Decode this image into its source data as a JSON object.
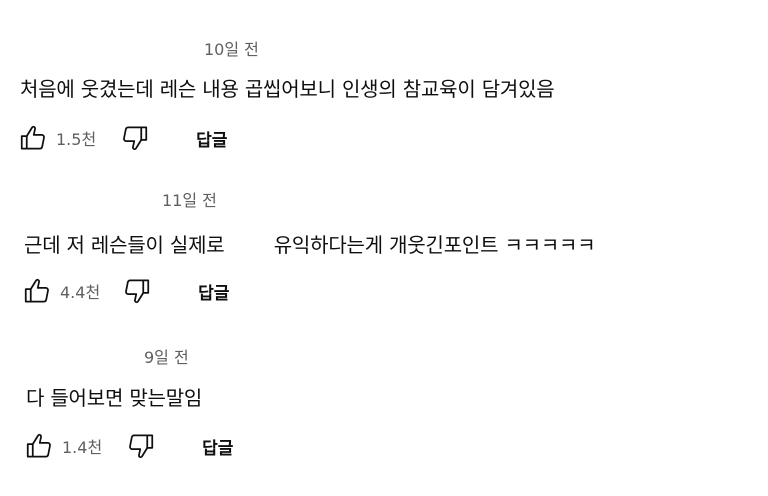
{
  "comments": [
    {
      "timestamp": "10일 전",
      "text": "처음에 웃겼는데 레슨 내용 곱씹어보니 인생의 참교육이 담겨있음",
      "like_count": "1.5천",
      "reply_label": "답글",
      "like_icon": "thumb-up-icon",
      "dislike_icon": "thumb-down-icon"
    },
    {
      "timestamp": "11일 전",
      "text": "근데 저 레슨들이 실제로        유익하다는게 개웃긴포인트 ㅋㅋㅋㅋㅋ",
      "like_count": "4.4천",
      "reply_label": "답글",
      "like_icon": "thumb-up-icon",
      "dislike_icon": "thumb-down-icon"
    },
    {
      "timestamp": "9일 전",
      "text": "다 들어보면 맞는말임",
      "like_count": "1.4천",
      "reply_label": "답글",
      "like_icon": "thumb-up-icon",
      "dislike_icon": "thumb-down-icon"
    }
  ]
}
